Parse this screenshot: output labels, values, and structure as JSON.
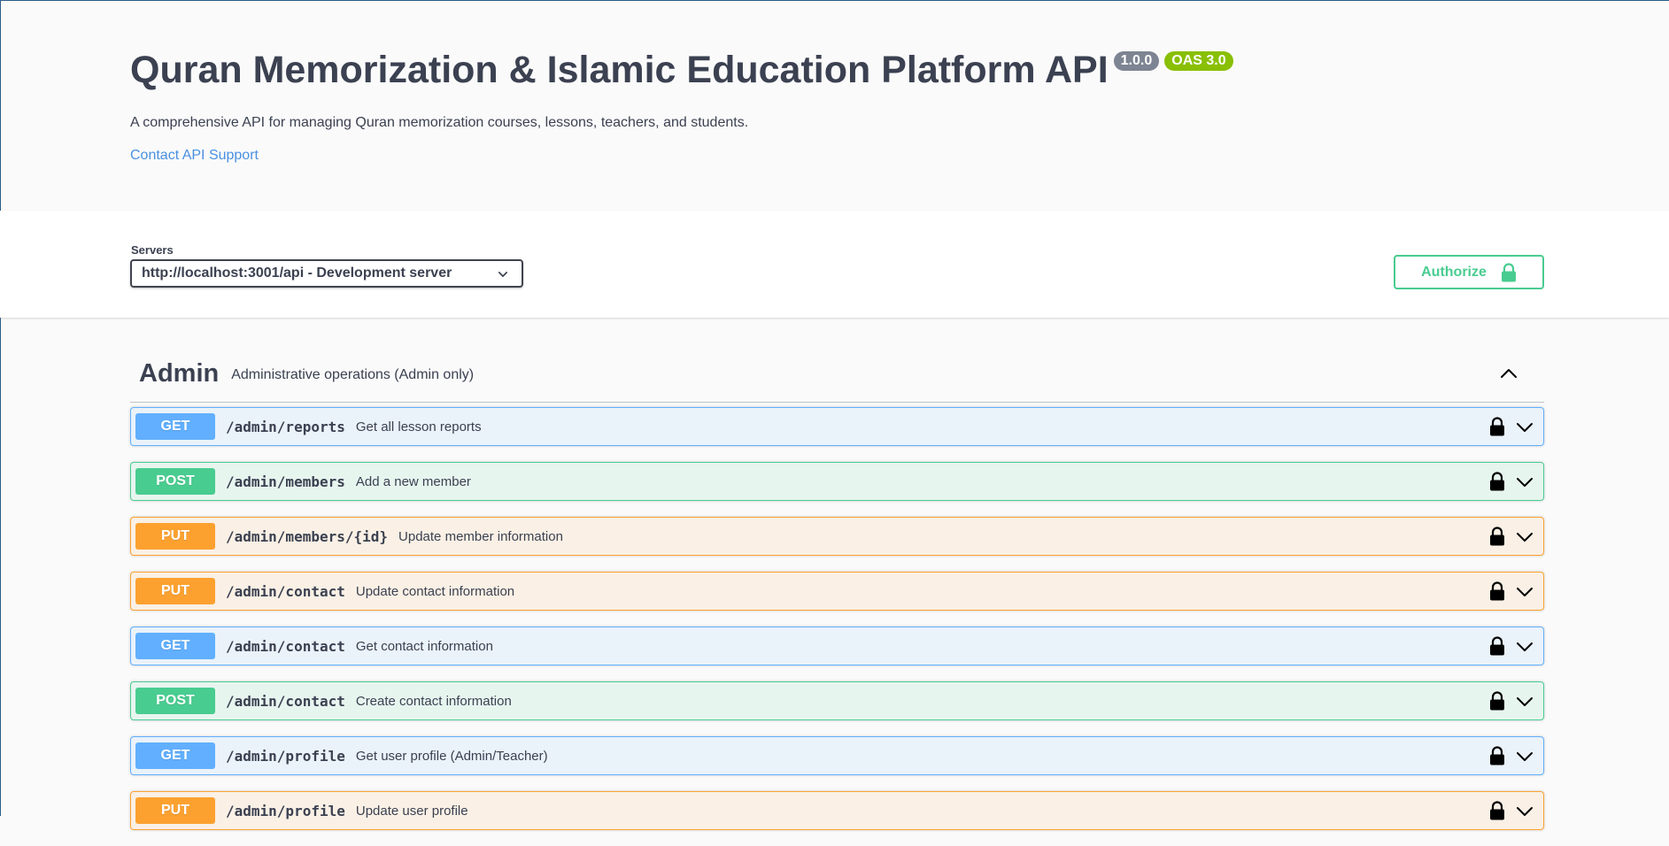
{
  "info": {
    "title": "Quran Memorization & Islamic Education Platform API",
    "version": "1.0.0",
    "oas": "OAS 3.0",
    "description": "A comprehensive API for managing Quran memorization courses, lessons, teachers, and students.",
    "contact_label": "Contact API Support"
  },
  "servers": {
    "label": "Servers",
    "selected": "http://localhost:3001/api - Development server"
  },
  "authorize": {
    "label": "Authorize",
    "icon": "lock-icon"
  },
  "tag": {
    "name": "Admin",
    "description": "Administrative operations (Admin only)",
    "expanded": true
  },
  "operations": [
    {
      "method": "GET",
      "path": "/admin/reports",
      "summary": "Get all lesson reports"
    },
    {
      "method": "POST",
      "path": "/admin/members",
      "summary": "Add a new member"
    },
    {
      "method": "PUT",
      "path": "/admin/members/{id}",
      "summary": "Update member information"
    },
    {
      "method": "PUT",
      "path": "/admin/contact",
      "summary": "Update contact information"
    },
    {
      "method": "GET",
      "path": "/admin/contact",
      "summary": "Get contact information"
    },
    {
      "method": "POST",
      "path": "/admin/contact",
      "summary": "Create contact information"
    },
    {
      "method": "GET",
      "path": "/admin/profile",
      "summary": "Get user profile (Admin/Teacher)"
    },
    {
      "method": "PUT",
      "path": "/admin/profile",
      "summary": "Update user profile"
    }
  ],
  "colors": {
    "get": "#61affe",
    "post": "#49cc90",
    "put": "#fca130",
    "version_badge": "#7d8492",
    "oas_badge": "#89bf04",
    "link": "#4990e2"
  }
}
